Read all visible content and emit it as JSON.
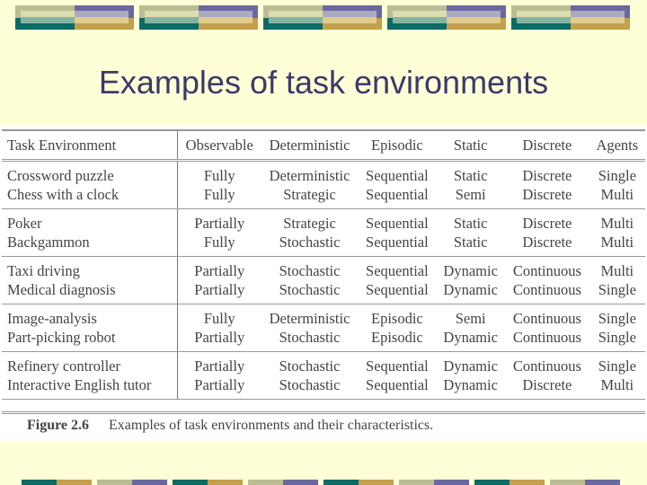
{
  "slide": {
    "title": "Examples of task environments",
    "colors": {
      "background": "#ffffd7",
      "title": "#3a3a6a",
      "teal": "#0d6b66",
      "gold": "#c4a04c",
      "khaki": "#bcbc94",
      "purple": "#6a68a0"
    }
  },
  "table": {
    "headers": [
      "Task Environment",
      "Observable",
      "Deterministic",
      "Episodic",
      "Static",
      "Discrete",
      "Agents"
    ],
    "groups": [
      [
        [
          "Crossword puzzle",
          "Fully",
          "Deterministic",
          "Sequential",
          "Static",
          "Discrete",
          "Single"
        ],
        [
          "Chess with a clock",
          "Fully",
          "Strategic",
          "Sequential",
          "Semi",
          "Discrete",
          "Multi"
        ]
      ],
      [
        [
          "Poker",
          "Partially",
          "Strategic",
          "Sequential",
          "Static",
          "Discrete",
          "Multi"
        ],
        [
          "Backgammon",
          "Fully",
          "Stochastic",
          "Sequential",
          "Static",
          "Discrete",
          "Multi"
        ]
      ],
      [
        [
          "Taxi driving",
          "Partially",
          "Stochastic",
          "Sequential",
          "Dynamic",
          "Continuous",
          "Multi"
        ],
        [
          "Medical diagnosis",
          "Partially",
          "Stochastic",
          "Sequential",
          "Dynamic",
          "Continuous",
          "Single"
        ]
      ],
      [
        [
          "Image-analysis",
          "Fully",
          "Deterministic",
          "Episodic",
          "Semi",
          "Continuous",
          "Single"
        ],
        [
          "Part-picking robot",
          "Partially",
          "Stochastic",
          "Episodic",
          "Dynamic",
          "Continuous",
          "Single"
        ]
      ],
      [
        [
          "Refinery controller",
          "Partially",
          "Stochastic",
          "Sequential",
          "Dynamic",
          "Continuous",
          "Single"
        ],
        [
          "Interactive English tutor",
          "Partially",
          "Stochastic",
          "Sequential",
          "Dynamic",
          "Discrete",
          "Multi"
        ]
      ]
    ]
  },
  "caption": {
    "label": "Figure 2.6",
    "text": "Examples of task environments and their characteristics."
  }
}
